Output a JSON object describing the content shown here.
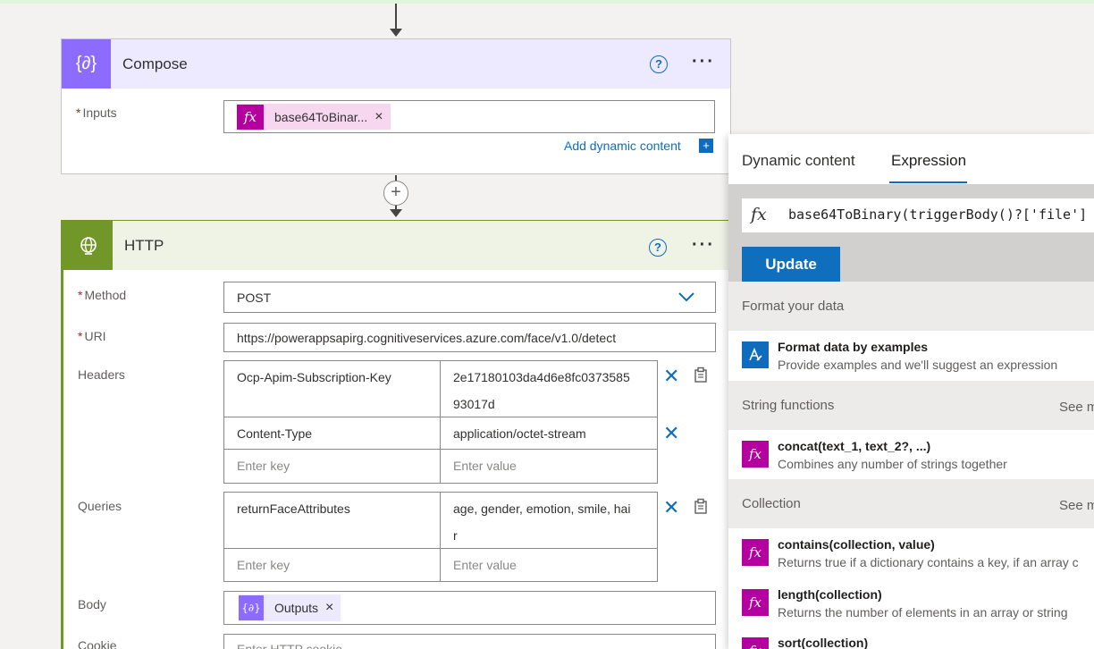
{
  "colors": {
    "compose_accent": "#8c6cff",
    "compose_header_bg": "#ede9ff",
    "http_accent": "#709727",
    "http_header_bg": "#eef3e6",
    "fx_token": "#b4009e",
    "link": "#0f6cbd"
  },
  "compose": {
    "title": "Compose",
    "inputs_label": "Inputs",
    "inputs_token": "base64ToBinar...",
    "add_dynamic_content": "Add dynamic content",
    "icon": "braces-icon"
  },
  "http": {
    "title": "HTTP",
    "method_label": "Method",
    "method_value": "POST",
    "uri_label": "URI",
    "uri_value": "https://powerappsapirg.cognitiveservices.azure.com/face/v1.0/detect",
    "headers_label": "Headers",
    "headers": [
      {
        "key": "Ocp-Apim-Subscription-Key",
        "value": "2e17180103da4d6e8fc0373585",
        "value2": "93017d"
      },
      {
        "key": "Content-Type",
        "value": "application/octet-stream"
      }
    ],
    "key_placeholder": "Enter key",
    "value_placeholder": "Enter value",
    "queries_label": "Queries",
    "query": {
      "key": "returnFaceAttributes",
      "value": "age, gender, emotion, smile, hai",
      "value2": "r"
    },
    "body_label": "Body",
    "body_token": "Outputs",
    "cookie_label": "Cookie",
    "cookie_placeholder": "Enter HTTP cookie",
    "icon": "globe-icon"
  },
  "panel": {
    "tabs": [
      "Dynamic content",
      "Expression"
    ],
    "active_tab": "Expression",
    "expression": "base64ToBinary(triggerBody()?['file']",
    "update_label": "Update",
    "sections": [
      {
        "title": "Format your data",
        "see_more": ""
      },
      {
        "title": "String functions",
        "see_more": "See m"
      },
      {
        "title": "Collection",
        "see_more": "See m"
      }
    ],
    "format_item": {
      "title": "Format data by examples",
      "desc": "Provide examples and we'll suggest an expression"
    },
    "string_item": {
      "title": "concat(text_1, text_2?, ...)",
      "desc": "Combines any number of strings together"
    },
    "collection_items": [
      {
        "title": "contains(collection, value)",
        "desc": "Returns true if a dictionary contains a key, if an array c"
      },
      {
        "title": "length(collection)",
        "desc": "Returns the number of elements in an array or string"
      },
      {
        "title": "sort(collection)",
        "desc": ""
      }
    ]
  }
}
